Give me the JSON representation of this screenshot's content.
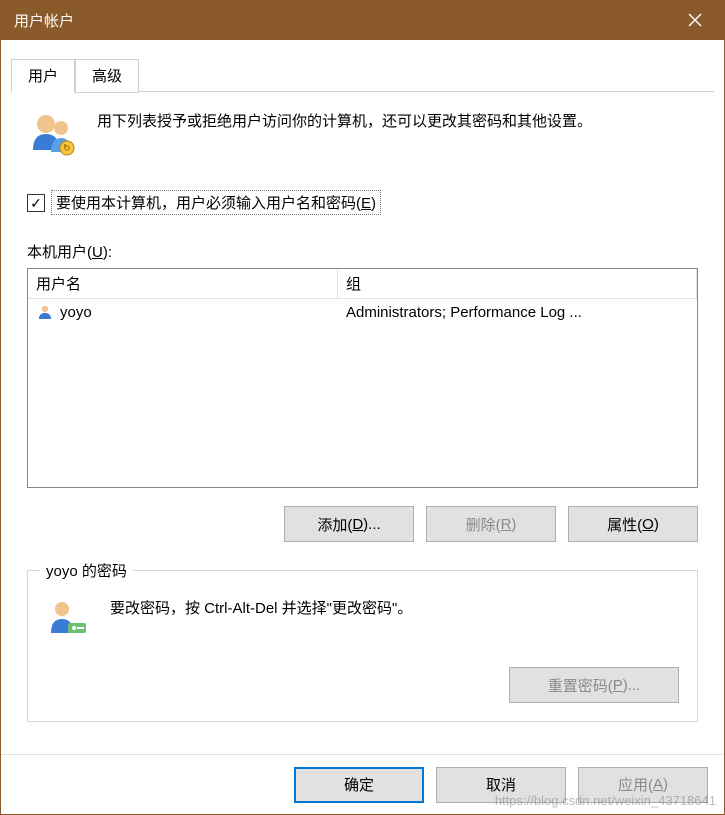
{
  "window": {
    "title": "用户帐户"
  },
  "tabs": {
    "user": "用户",
    "advanced": "高级"
  },
  "intro": "用下列表授予或拒绝用户访问你的计算机，还可以更改其密码和其他设置。",
  "checkbox": {
    "label_pre": "要使用本计算机，用户必须输入用户名和密码(",
    "hotkey": "E",
    "label_post": ")"
  },
  "list": {
    "label_pre": "本机用户(",
    "hotkey": "U",
    "label_post": "):",
    "col_name": "用户名",
    "col_group": "组",
    "rows": [
      {
        "name": "yoyo",
        "group": "Administrators; Performance Log ..."
      }
    ]
  },
  "buttons": {
    "add_pre": "添加(",
    "add_hot": "D",
    "add_post": ")...",
    "remove_pre": "删除(",
    "remove_hot": "R",
    "remove_post": ")",
    "props_pre": "属性(",
    "props_hot": "O",
    "props_post": ")"
  },
  "password_group": {
    "legend": "yoyo 的密码",
    "text": "要改密码，按 Ctrl-Alt-Del 并选择\"更改密码\"。",
    "reset_pre": "重置密码(",
    "reset_hot": "P",
    "reset_post": ")..."
  },
  "bottom": {
    "ok": "确定",
    "cancel": "取消",
    "apply_pre": "应用(",
    "apply_hot": "A",
    "apply_post": ")"
  },
  "watermark": "https://blog.csdn.net/weixin_43718641"
}
